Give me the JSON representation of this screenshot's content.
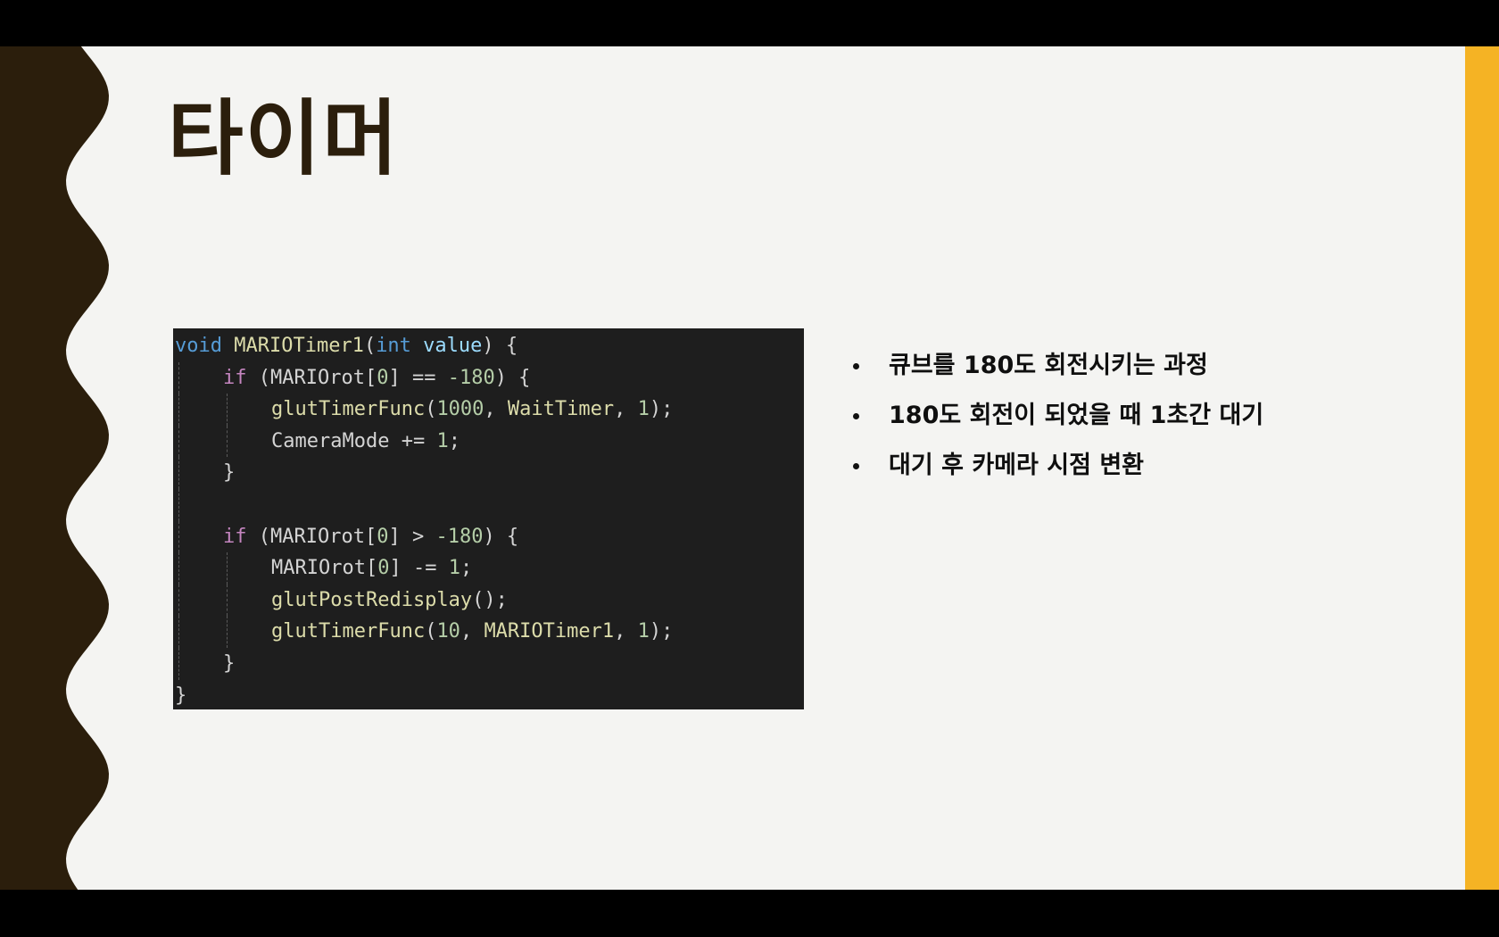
{
  "slide": {
    "title": "타이머",
    "colors": {
      "background": "#f4f4f2",
      "wave": "#2b1e0c",
      "accent": "#f5b324",
      "title": "#2b1e0c",
      "code_background": "#1e1e1e"
    }
  },
  "code": {
    "language": "c",
    "lines": [
      {
        "indent": 0,
        "tokens": [
          [
            "void",
            "keyword"
          ],
          [
            " ",
            "punct"
          ],
          [
            "MARIOTimer1",
            "func"
          ],
          [
            "(",
            "punct"
          ],
          [
            "int",
            "keyword"
          ],
          [
            " value",
            "param"
          ],
          [
            ") {",
            "brace"
          ]
        ]
      },
      {
        "indent": 1,
        "tokens": [
          [
            "if",
            "control"
          ],
          [
            " (",
            "punct"
          ],
          [
            "MARIOrot",
            "ident"
          ],
          [
            "[",
            "punct"
          ],
          [
            "0",
            "num"
          ],
          [
            "] == ",
            "punct"
          ],
          [
            "-180",
            "num"
          ],
          [
            ") {",
            "brace"
          ]
        ]
      },
      {
        "indent": 2,
        "tokens": [
          [
            "glutTimerFunc",
            "func"
          ],
          [
            "(",
            "punct"
          ],
          [
            "1000",
            "num"
          ],
          [
            ", ",
            "punct"
          ],
          [
            "WaitTimer",
            "func"
          ],
          [
            ", ",
            "punct"
          ],
          [
            "1",
            "num"
          ],
          [
            ");",
            "punct"
          ]
        ]
      },
      {
        "indent": 2,
        "tokens": [
          [
            "CameraMode",
            "ident"
          ],
          [
            " += ",
            "punct"
          ],
          [
            "1",
            "num"
          ],
          [
            ";",
            "punct"
          ]
        ]
      },
      {
        "indent": 1,
        "tokens": [
          [
            "}",
            "brace"
          ]
        ]
      },
      {
        "indent": 1,
        "tokens": []
      },
      {
        "indent": 1,
        "tokens": [
          [
            "if",
            "control"
          ],
          [
            " (",
            "punct"
          ],
          [
            "MARIOrot",
            "ident"
          ],
          [
            "[",
            "punct"
          ],
          [
            "0",
            "num"
          ],
          [
            "] > ",
            "punct"
          ],
          [
            "-180",
            "num"
          ],
          [
            ") {",
            "brace"
          ]
        ]
      },
      {
        "indent": 2,
        "tokens": [
          [
            "MARIOrot",
            "ident"
          ],
          [
            "[",
            "punct"
          ],
          [
            "0",
            "num"
          ],
          [
            "] -= ",
            "punct"
          ],
          [
            "1",
            "num"
          ],
          [
            ";",
            "punct"
          ]
        ]
      },
      {
        "indent": 2,
        "tokens": [
          [
            "glutPostRedisplay",
            "func"
          ],
          [
            "();",
            "punct"
          ]
        ]
      },
      {
        "indent": 2,
        "tokens": [
          [
            "glutTimerFunc",
            "func"
          ],
          [
            "(",
            "punct"
          ],
          [
            "10",
            "num"
          ],
          [
            ", ",
            "punct"
          ],
          [
            "MARIOTimer1",
            "func"
          ],
          [
            ", ",
            "punct"
          ],
          [
            "1",
            "num"
          ],
          [
            ");",
            "punct"
          ]
        ]
      },
      {
        "indent": 1,
        "tokens": [
          [
            "}",
            "brace"
          ]
        ]
      },
      {
        "indent": 0,
        "tokens": [
          [
            "}",
            "brace"
          ]
        ]
      }
    ]
  },
  "bullets": [
    "큐브를 180도 회전시키는 과정",
    "180도 회전이 되었을 때 1초간 대기",
    "대기 후 카메라 시점 변환"
  ]
}
